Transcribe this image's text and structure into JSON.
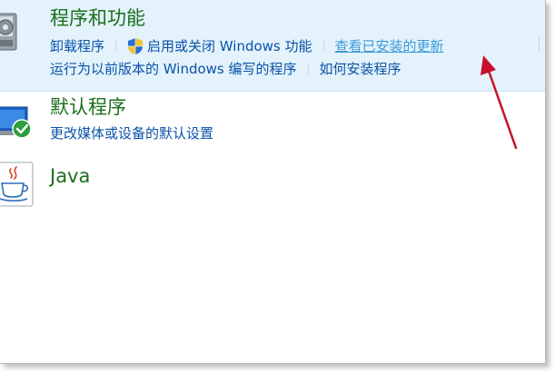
{
  "programs": {
    "title": "程序和功能",
    "icon": "programs-box-icon",
    "links": {
      "uninstall": "卸载程序",
      "windows_features": "启用或关闭 Windows 功能",
      "view_updates": "查看已安装的更新",
      "run_older": "运行为以前版本的 Windows 编写的程序",
      "how_to_install": "如何安装程序"
    }
  },
  "default_programs": {
    "title": "默认程序",
    "icon": "default-programs-check-icon",
    "links": {
      "change_defaults": "更改媒体或设备的默认设置"
    }
  },
  "java": {
    "title": "Java",
    "icon": "java-coffee-icon"
  },
  "annotation": {
    "icon": "red-arrow-icon",
    "color": "#c8102e"
  },
  "colors": {
    "category_title": "#1e6e1e",
    "link": "#0a52a8",
    "visited_link": "#3a9bd9",
    "highlight_bg": "#e3f2fb"
  }
}
